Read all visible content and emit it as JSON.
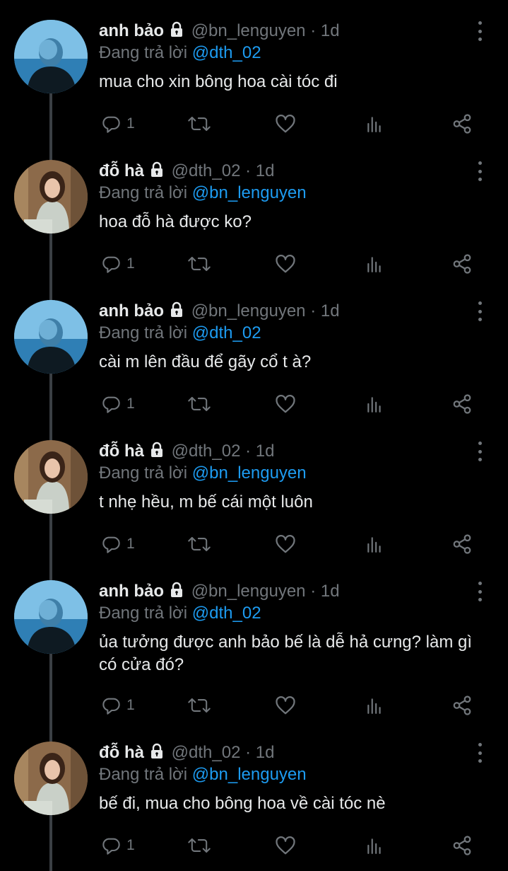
{
  "colors": {
    "background": "#000000",
    "text": "#e7e9ea",
    "muted": "#71767b",
    "link": "#1d9bf0"
  },
  "tweets": [
    {
      "author": "anh bảo",
      "handle": "@bn_lenguyen",
      "separator": "·",
      "time": "1d",
      "replying_label": "Đang trả lời",
      "replying_to": "@dth_02",
      "text": "mua cho xin bông hoa cài tóc đi",
      "reply_count": "1",
      "avatar": "blue-hair-avatar"
    },
    {
      "author": "đỗ hà",
      "handle": "@dth_02",
      "separator": "·",
      "time": "1d",
      "replying_label": "Đang trả lời",
      "replying_to": "@bn_lenguyen",
      "text": "hoa đỗ hà được ko?",
      "reply_count": "1",
      "avatar": "woman-avatar"
    },
    {
      "author": "anh bảo",
      "handle": "@bn_lenguyen",
      "separator": "·",
      "time": "1d",
      "replying_label": "Đang trả lời",
      "replying_to": "@dth_02",
      "text": "cài m lên đầu để gãy cổ t à?",
      "reply_count": "1",
      "avatar": "blue-hair-avatar"
    },
    {
      "author": "đỗ hà",
      "handle": "@dth_02",
      "separator": "·",
      "time": "1d",
      "replying_label": "Đang trả lời",
      "replying_to": "@bn_lenguyen",
      "text": "t nhẹ hều, m bế cái một luôn",
      "reply_count": "1",
      "avatar": "woman-avatar"
    },
    {
      "author": "anh bảo",
      "handle": "@bn_lenguyen",
      "separator": "·",
      "time": "1d",
      "replying_label": "Đang trả lời",
      "replying_to": "@dth_02",
      "text": "ủa tưởng được anh bảo bế là dễ hả cưng? làm gì có cửa đó?",
      "reply_count": "1",
      "avatar": "blue-hair-avatar"
    },
    {
      "author": "đỗ hà",
      "handle": "@dth_02",
      "separator": "·",
      "time": "1d",
      "replying_label": "Đang trả lời",
      "replying_to": "@bn_lenguyen",
      "text": "bế đi, mua cho bông hoa về cài tóc nè",
      "reply_count": "1",
      "avatar": "woman-avatar"
    }
  ]
}
